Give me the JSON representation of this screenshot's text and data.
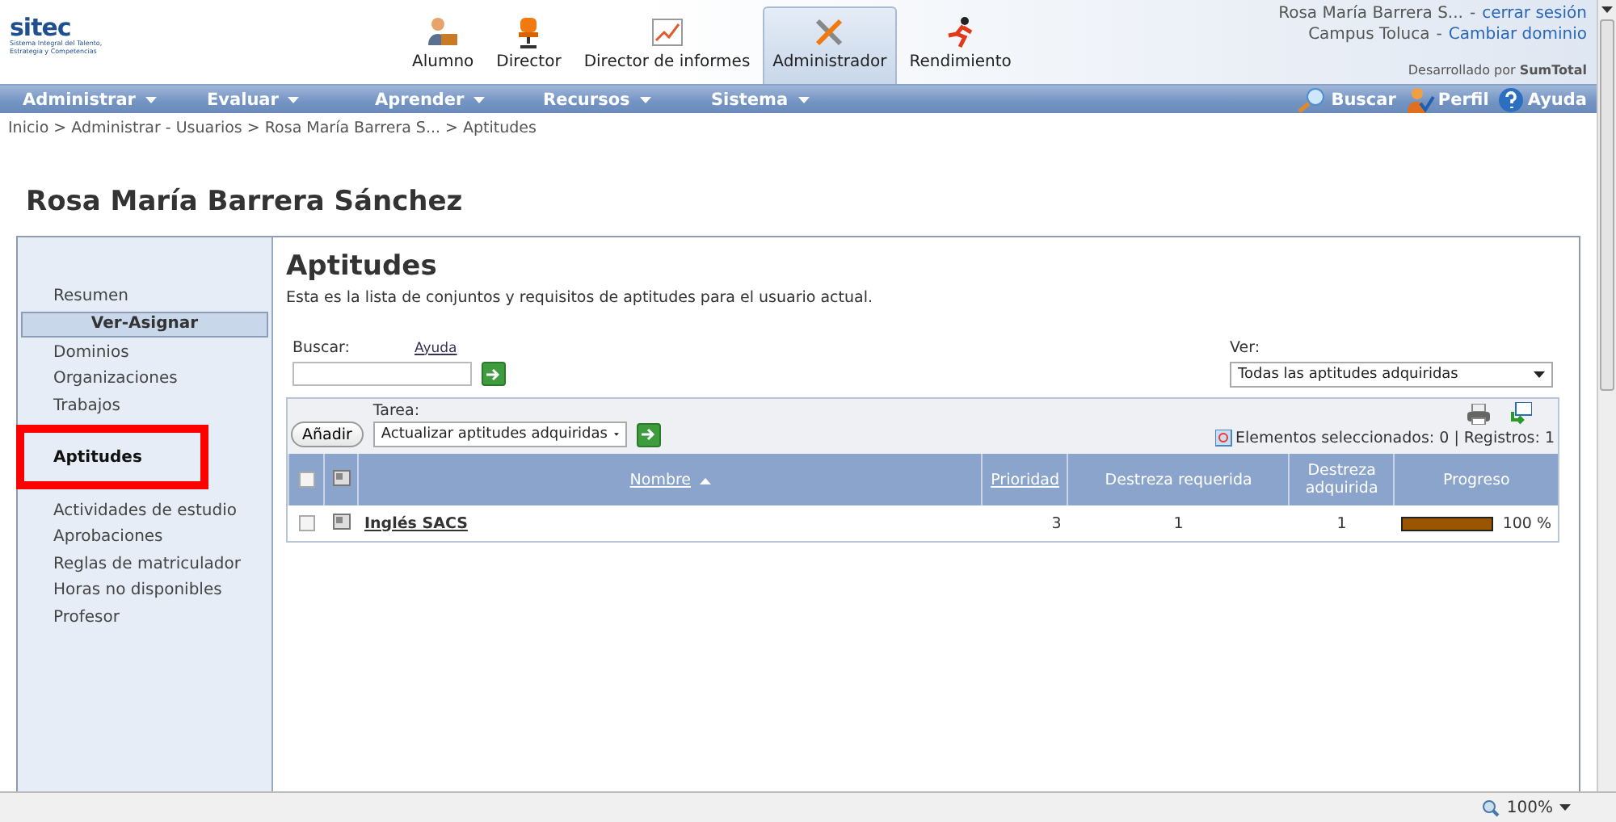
{
  "logo": {
    "name": "sitec",
    "tagline": "Sistema Integral del Talento, Estrategia y Competencias"
  },
  "roles": [
    {
      "label": "Alumno",
      "kind": "student",
      "selected": false
    },
    {
      "label": "Director",
      "kind": "chair",
      "selected": false
    },
    {
      "label": "Director de informes",
      "kind": "chart",
      "selected": false
    },
    {
      "label": "Administrador",
      "kind": "tools",
      "selected": true
    },
    {
      "label": "Rendimiento",
      "kind": "runner",
      "selected": false
    }
  ],
  "user": {
    "name": "Rosa María Barrera S...",
    "separator": "-",
    "logout": "cerrar sesión",
    "domain": "Campus Toluca",
    "domain_separator": "-",
    "change_domain": "Cambiar dominio",
    "credit": "Desarrollado por **SumTotal**"
  },
  "menu": [
    "Administrar",
    "Evaluar",
    "Aprender",
    "Recursos",
    "Sistema"
  ],
  "tools": [
    {
      "label": "Buscar",
      "kind": "search"
    },
    {
      "label": "Perfil",
      "kind": "profile"
    },
    {
      "label": "Ayuda",
      "kind": "help"
    }
  ],
  "breadcrumb": "Inicio > Administrar - Usuarios > Rosa María Barrera S... > Aptitudes",
  "page_title": "Rosa María Barrera Sánchez",
  "sidebar": {
    "items": [
      {
        "label": "Resumen",
        "kind": "link",
        "selected": false,
        "annotated": false
      },
      {
        "label": "Ver-Asignar",
        "kind": "header"
      },
      {
        "label": "Dominios",
        "kind": "link",
        "selected": false,
        "annotated": false
      },
      {
        "label": "Organizaciones",
        "kind": "link",
        "selected": false,
        "annotated": false
      },
      {
        "label": "Trabajos",
        "kind": "link",
        "selected": false,
        "annotated": false
      },
      {
        "label": "Aptitudes",
        "kind": "link",
        "selected": true,
        "annotated": true
      },
      {
        "label": "Actividades de estudio",
        "kind": "link",
        "selected": false,
        "annotated": false
      },
      {
        "label": "Aprobaciones",
        "kind": "link",
        "selected": false,
        "annotated": false
      },
      {
        "label": "Reglas de matriculador",
        "kind": "link",
        "selected": false,
        "annotated": false
      },
      {
        "label": "Horas no disponibles",
        "kind": "link",
        "selected": false,
        "annotated": false
      },
      {
        "label": "Profesor",
        "kind": "link",
        "selected": false,
        "annotated": false
      }
    ]
  },
  "content": {
    "heading": "Aptitudes",
    "description": "Esta es la lista de conjuntos y requisitos de aptitudes para el usuario actual.",
    "search": {
      "label": "Buscar:",
      "help": "Ayuda"
    },
    "view": {
      "label": "Ver:",
      "value": "Todas las aptitudes adquiridas"
    },
    "task": {
      "label": "Tarea:",
      "value": "Actualizar aptitudes adquiridas",
      "add_button": "Añadir"
    },
    "summary": "Elementos seleccionados: 0 | Registros: 1",
    "table": {
      "select_all_checked": false,
      "columns": [
        {
          "label": "Nombre",
          "kind": "link",
          "sorted": true
        },
        {
          "label": "Prioridad",
          "kind": "link",
          "sorted": false
        },
        {
          "label": "Destreza requerida",
          "kind": "plain",
          "sorted": false
        },
        {
          "label": "Destreza adquirida",
          "kind": "plain",
          "sorted": false
        },
        {
          "label": "Progreso",
          "kind": "plain",
          "sorted": false
        }
      ],
      "rows": [
        {
          "checked": false,
          "name": "Inglés SACS",
          "priority": "3",
          "required": "1",
          "acquired": "1",
          "level": 1,
          "progress": "100 %"
        }
      ]
    }
  },
  "status_bar": {
    "zoom": "100%"
  }
}
